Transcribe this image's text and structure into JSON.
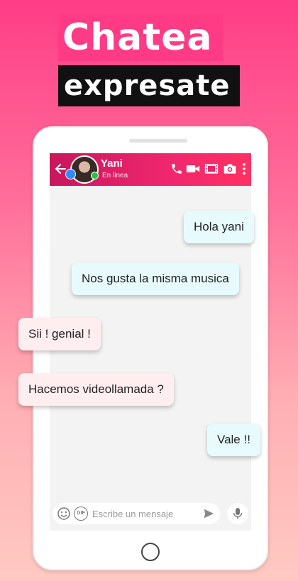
{
  "headline": {
    "line1": "Chatea",
    "line2": "expresate"
  },
  "chat": {
    "contact_name": "Yani",
    "contact_status": "En linea",
    "input_placeholder": "Escribe un mensaje",
    "gif_label": "GIF",
    "accent_color": "#f0276e"
  },
  "messages": [
    {
      "text": "Hola yani",
      "direction": "outgoing"
    },
    {
      "text": "Nos gusta la misma musica",
      "direction": "outgoing"
    },
    {
      "text": "Sii ! genial !",
      "direction": "incoming"
    },
    {
      "text": "Hacemos videollamada ?",
      "direction": "incoming"
    },
    {
      "text": "Vale !!",
      "direction": "outgoing"
    }
  ],
  "icons": [
    "back-arrow-icon",
    "phone-icon",
    "video-camera-icon",
    "film-icon",
    "camera-icon",
    "more-vert-icon",
    "emoji-icon",
    "gif-icon",
    "send-icon",
    "mic-icon"
  ]
}
